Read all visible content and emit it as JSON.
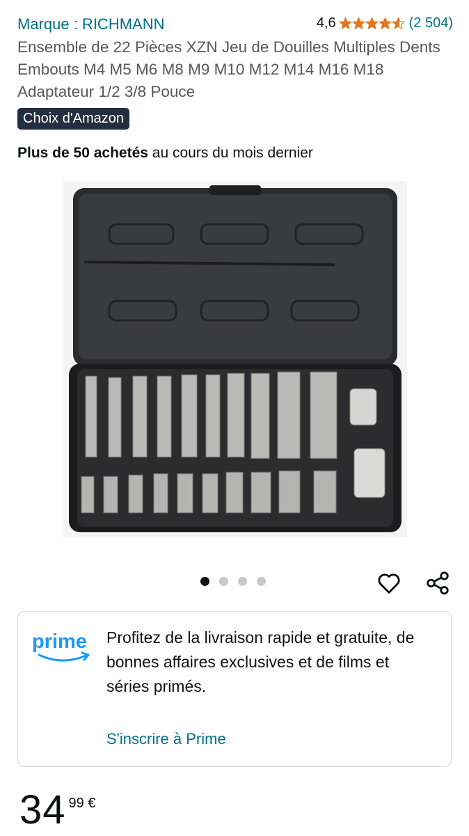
{
  "product": {
    "brand": "Marque : RICHMANN",
    "rating": "4,6",
    "rating_value": 4.6,
    "rating_count": "(2 504)",
    "title": "Ensemble de 22 Pièces XZN Jeu de Douilles Multiples Dents Embouts M4 M5 M6 M8 M9 M10 M12 M14 M16 M18 Adaptateur 1/2 3/8 Pouce",
    "badge": "Choix d'Amazon",
    "bought_bold": "Plus de 50 achetés",
    "bought_rest": " au cours du mois dernier"
  },
  "gallery": {
    "dot_count": 4,
    "active_index": 0,
    "icons": [
      "heart-icon",
      "share-icon"
    ]
  },
  "prime": {
    "logo_text": "prime",
    "message": "Profitez de la livraison rapide et gratuite, de bonnes affaires exclusives et de films et séries primés.",
    "link": "S'inscrire à Prime"
  },
  "price": {
    "whole": "34",
    "fraction": "99 €"
  },
  "colors": {
    "link": "#007185",
    "star": "#de7921",
    "badge_bg": "#232f3e",
    "prime_blue": "#1a98ff"
  }
}
